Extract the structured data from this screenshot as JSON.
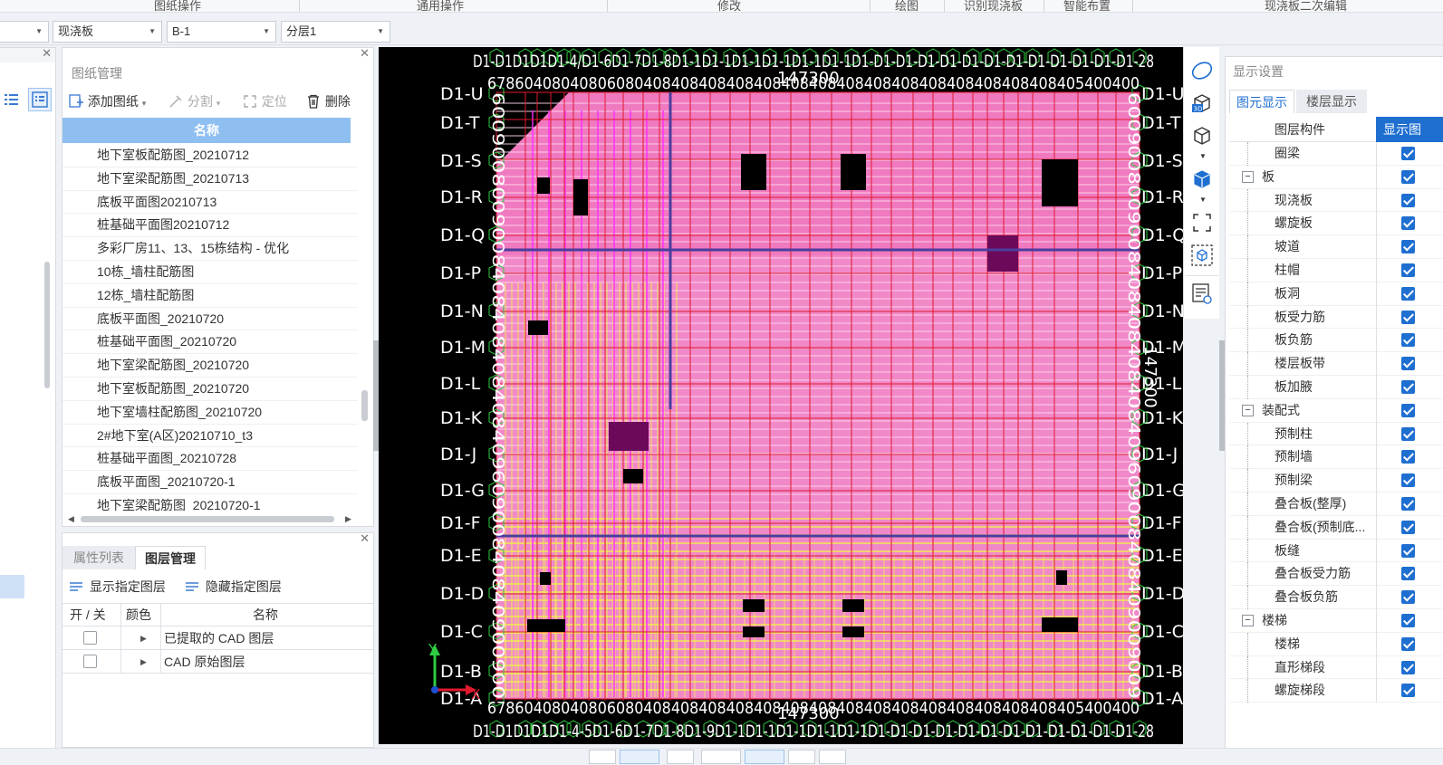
{
  "ribbon": {
    "groups": [
      "图纸操作",
      "通用操作",
      "修改",
      "绘图",
      "识别现浇板",
      "智能布置",
      "现浇板二次编辑"
    ]
  },
  "selectors": {
    "floor": "",
    "category": "现浇板",
    "component": "B-1",
    "layer": "分层1"
  },
  "drawing_panel": {
    "title": "图纸管理",
    "add_label": "添加图纸",
    "split_label": "分割",
    "locate_label": "定位",
    "delete_label": "删除",
    "column_header": "名称",
    "items": [
      "地下室板配筋图_20210712",
      "地下室梁配筋图_20210713",
      "底板平面图20210713",
      "桩基础平面图20210712",
      "多彩厂房11、13、15栋结构 - 优化",
      "10栋_墙柱配筋图",
      "12栋_墙柱配筋图",
      "底板平面图_20210720",
      "桩基础平面图_20210720",
      "地下室梁配筋图_20210720",
      "地下室板配筋图_20210720",
      "地下室墙柱配筋图_20210720",
      "2#地下室(A区)20210710_t3",
      "桩基础平面图_20210728",
      "底板平面图_20210720-1",
      "地下室梁配筋图_20210720-1"
    ]
  },
  "layer_panel": {
    "tabs": [
      "属性列表",
      "图层管理"
    ],
    "active_tab": "图层管理",
    "show_label": "显示指定图层",
    "hide_label": "隐藏指定图层",
    "headers": [
      "开 / 关",
      "颜色",
      "名称"
    ],
    "rows": [
      {
        "name": "已提取的 CAD 图层",
        "checked": false
      },
      {
        "name": "CAD 原始图层",
        "checked": false
      }
    ]
  },
  "canvas": {
    "top_dimension": "147300",
    "bottom_dimension": "147300",
    "axis_label_top": "D1-D1D1D1D1-4/D1-6D1-7D1-8D1-1D1-1D1-1D1-1D1-1D1-1D1-D1-D1-D1-D1-D1-D1-D1-D1-D1-D1-D1-D1-28",
    "axis_label_bottom": "D1-D1D1D1D1-4-5D1-6D1-7D1-8D1-9D1-1D1-1D1-1D1-1D1-1D1-D1-D1-D1-D1-D1-D1-D1-D1-D1-D1-D1-28",
    "spacing_row": "67860408040806080408408408408408408408408408408408408408408408405400400",
    "left_axis": [
      "D1-U",
      "D1-T",
      "D1-S",
      "D1-R",
      "D1-Q",
      "D1-P",
      "D1-N",
      "D1-M",
      "D1-L",
      "D1-K",
      "D1-J",
      "D1-G",
      "D1-F",
      "D1-E",
      "D1-D",
      "D1-C",
      "D1-B",
      "D1-A"
    ],
    "right_axis": [
      "D1-U",
      "D1-T",
      "D1-S",
      "D1-R",
      "D1-Q",
      "D1-P",
      "D1-N",
      "D1-M",
      "D1-L",
      "D1-K",
      "D1-J",
      "D1-G",
      "D1-F",
      "D1-E",
      "D1-D",
      "D1-C",
      "D1-B",
      "D1-A"
    ],
    "left_dim_text": "600900800900840840840840840960900840840900900",
    "right_dim_text": "6009008009008408408408408409609008408409009009",
    "right_side_number": "147300",
    "coord_x": "X",
    "coord_y": "Y"
  },
  "view_toolbar": {
    "icons": [
      "dynamic-observe-icon",
      "3d-view-icon",
      "cube-view-icon",
      "cube-solid-icon",
      "fullscreen-icon",
      "component-box-icon",
      "layer-list-icon"
    ]
  },
  "display_panel": {
    "title": "显示设置",
    "tabs": [
      "图元显示",
      "楼层显示"
    ],
    "active_tab": "图元显示",
    "headers": [
      "图层构件",
      "显示图"
    ],
    "rows": [
      {
        "label": "圈梁",
        "indent": 1,
        "group": false,
        "checked": true
      },
      {
        "label": "板",
        "indent": 0,
        "group": true,
        "checked": true
      },
      {
        "label": "现浇板",
        "indent": 1,
        "group": false,
        "checked": true
      },
      {
        "label": "螺旋板",
        "indent": 1,
        "group": false,
        "checked": true
      },
      {
        "label": "坡道",
        "indent": 1,
        "group": false,
        "checked": true
      },
      {
        "label": "柱帽",
        "indent": 1,
        "group": false,
        "checked": true
      },
      {
        "label": "板洞",
        "indent": 1,
        "group": false,
        "checked": true
      },
      {
        "label": "板受力筋",
        "indent": 1,
        "group": false,
        "checked": true
      },
      {
        "label": "板负筋",
        "indent": 1,
        "group": false,
        "checked": true
      },
      {
        "label": "楼层板带",
        "indent": 1,
        "group": false,
        "checked": true
      },
      {
        "label": "板加腋",
        "indent": 1,
        "group": false,
        "checked": true
      },
      {
        "label": "装配式",
        "indent": 0,
        "group": true,
        "checked": true
      },
      {
        "label": "预制柱",
        "indent": 1,
        "group": false,
        "checked": true
      },
      {
        "label": "预制墙",
        "indent": 1,
        "group": false,
        "checked": true
      },
      {
        "label": "预制梁",
        "indent": 1,
        "group": false,
        "checked": true
      },
      {
        "label": "叠合板(整厚)",
        "indent": 1,
        "group": false,
        "checked": true
      },
      {
        "label": "叠合板(预制底...",
        "indent": 1,
        "group": false,
        "checked": true
      },
      {
        "label": "板缝",
        "indent": 1,
        "group": false,
        "checked": true
      },
      {
        "label": "叠合板受力筋",
        "indent": 1,
        "group": false,
        "checked": true
      },
      {
        "label": "叠合板负筋",
        "indent": 1,
        "group": false,
        "checked": true
      },
      {
        "label": "楼梯",
        "indent": 0,
        "group": true,
        "checked": true
      },
      {
        "label": "楼梯",
        "indent": 1,
        "group": false,
        "checked": true
      },
      {
        "label": "直形梯段",
        "indent": 1,
        "group": false,
        "checked": true
      },
      {
        "label": "螺旋梯段",
        "indent": 1,
        "group": false,
        "checked": true
      }
    ]
  },
  "colors": {
    "accent": "#1f6fd1",
    "slab_pink": "#f07ac0",
    "rebar_yellow": "#f2f24a",
    "grid_red": "#e0192e",
    "magenta": "#ff2bff",
    "header_blue": "#8fbff0"
  }
}
